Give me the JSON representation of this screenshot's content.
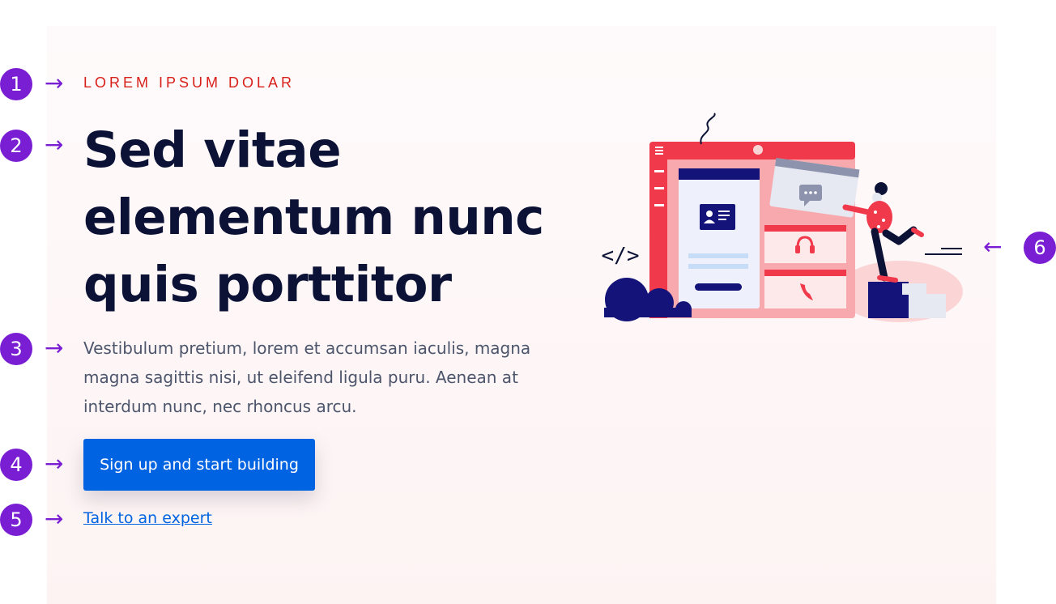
{
  "hero": {
    "eyebrow": "LOREM IPSUM DOLAR",
    "headline": "Sed vitae elementum nunc quis porttitor",
    "body": "Vestibulum pretium, lorem et accumsan iaculis, magna magna sagittis nisi, ut eleifend ligula puru. Aenean at interdum nunc, nec rhoncus arcu.",
    "cta_label": "Sign up and start building",
    "link_label": "Talk to an expert"
  },
  "annotations": {
    "markers": [
      "1",
      "2",
      "3",
      "4",
      "5",
      "6"
    ],
    "arrow_right": "→",
    "arrow_left": "←"
  },
  "illustration": {
    "code_symbol": "</>",
    "icons": [
      "menu-icon",
      "profile-card-icon",
      "chat-bubble-icon",
      "headset-icon",
      "phone-icon",
      "code-brackets-icon"
    ]
  },
  "colors": {
    "annotation": "#7a1ed4",
    "eyebrow": "#d8201b",
    "headline": "#0b1236",
    "body": "#4c556b",
    "accent": "#0063e1",
    "illustration_red": "#f03a4c",
    "illustration_navy": "#14137a"
  }
}
